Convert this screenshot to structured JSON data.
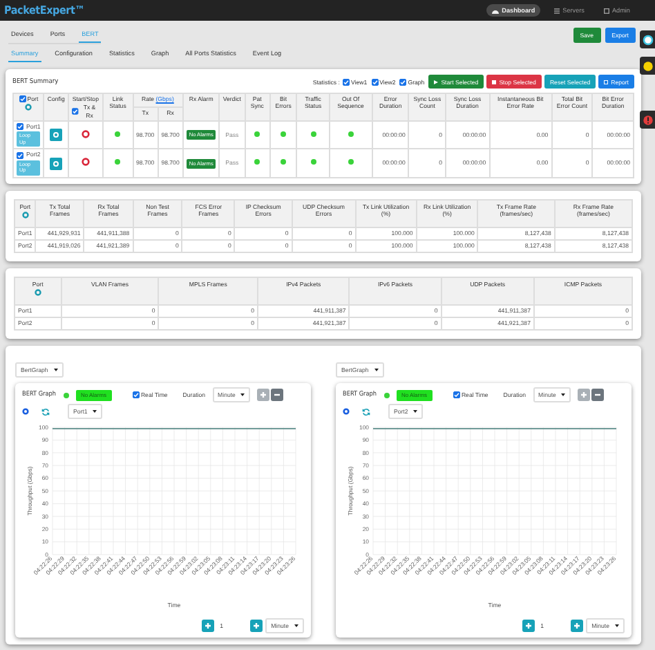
{
  "header": {
    "brand": "PacketExpert™",
    "nav": [
      {
        "label": "Dashboard",
        "selected": true,
        "kind": "dashboard"
      },
      {
        "label": "Servers",
        "selected": false,
        "kind": "servers"
      },
      {
        "label": "Admin",
        "selected": false,
        "kind": "admin"
      }
    ]
  },
  "tabs": [
    {
      "label": "Devices",
      "selected": false
    },
    {
      "label": "Ports",
      "selected": false
    },
    {
      "label": "BERT",
      "selected": true
    }
  ],
  "actions": [
    {
      "label": "Save",
      "kind": "success"
    },
    {
      "label": "Export",
      "kind": "primary"
    }
  ],
  "subtabs": [
    {
      "label": "Summary",
      "selected": true
    },
    {
      "label": "Configuration",
      "selected": false
    },
    {
      "label": "Statistics",
      "selected": false
    },
    {
      "label": "Graph",
      "selected": false
    },
    {
      "label": "All Ports Statistics",
      "selected": false
    },
    {
      "label": "Event Log",
      "selected": false
    }
  ],
  "summary": {
    "title": "BERT Summary",
    "statistics_label": "Statistics :",
    "views": [
      {
        "label": "View1",
        "checked": true
      },
      {
        "label": "View2",
        "checked": true
      },
      {
        "label": "Graph",
        "checked": true
      }
    ],
    "buttons": [
      {
        "label": "Start Selected",
        "kind": "success"
      },
      {
        "label": "Stop Selected",
        "kind": "danger"
      },
      {
        "label": "Reset Selected",
        "kind": "info"
      },
      {
        "label": "Report",
        "kind": "primary"
      }
    ],
    "head": {
      "port": "Port",
      "port_checked": true,
      "config": "Config",
      "start_stop": "Start/Stop",
      "txrx": "Tx & Rx",
      "txrx_checked": true,
      "link_status": "Link Status",
      "rate": "Rate",
      "rate_unit": "(Gbps)",
      "tx": "Tx",
      "rx": "Rx",
      "other": [
        "Rx Alarm",
        "Verdict",
        "Pat Sync",
        "Bit Errors",
        "Traffic Status",
        "Out Of Sequence",
        "Error Duration",
        "Sync Loss Count",
        "Sync Loss Duration",
        "Instantaneous Bit Error Rate",
        "Total Bit Error Count",
        "Bit Error Duration"
      ]
    },
    "rows": [
      {
        "port": "Port1",
        "checked": true,
        "loop": "Loop Up",
        "link_ok": true,
        "tx": "98.700",
        "rx": "98.700",
        "alarm": "No Alarms",
        "verdict": "Pass",
        "pat_sync": true,
        "bit_errors": true,
        "traffic": true,
        "sequence": true,
        "error_duration": "00:00:00",
        "sync_loss_count": "0",
        "sync_loss_duration": "00:00:00",
        "ber": "0.00",
        "total_bit_errors": "0",
        "bit_error_duration": "00:00:00"
      },
      {
        "port": "Port2",
        "checked": true,
        "loop": "Loop Up",
        "link_ok": true,
        "tx": "98.700",
        "rx": "98.700",
        "alarm": "No Alarms",
        "verdict": "Pass",
        "pat_sync": true,
        "bit_errors": true,
        "traffic": true,
        "sequence": true,
        "error_duration": "00:00:00",
        "sync_loss_count": "0",
        "sync_loss_duration": "00:00:00",
        "ber": "0.00",
        "total_bit_errors": "0",
        "bit_error_duration": "00:00:00"
      }
    ]
  },
  "frame_stats": {
    "columns": [
      "Port",
      "Tx Total Frames",
      "Rx Total Frames",
      "Non Test Frames",
      "FCS Error Frames",
      "IP Checksum Errors",
      "UDP Checksum Errors",
      "Tx Link Utilization (%)",
      "Rx Link Utilization (%)",
      "Tx Frame Rate (frames/sec)",
      "Rx Frame Rate (frames/sec)"
    ],
    "rows": [
      [
        "Port1",
        "441,929,931",
        "441,911,388",
        "0",
        "0",
        "0",
        "0",
        "100.000",
        "100.000",
        "8,127,438",
        "8,127,438"
      ],
      [
        "Port2",
        "441,919,026",
        "441,921,389",
        "0",
        "0",
        "0",
        "0",
        "100.000",
        "100.000",
        "8,127,438",
        "8,127,438"
      ]
    ]
  },
  "packet_stats": {
    "columns": [
      "Port",
      "VLAN Frames",
      "MPLS Frames",
      "IPv4 Packets",
      "IPv6 Packets",
      "UDP Packets",
      "ICMP Packets"
    ],
    "rows": [
      [
        "Port1",
        "0",
        "0",
        "441,911,387",
        "0",
        "441,911,387",
        "0"
      ],
      [
        "Port2",
        "0",
        "0",
        "441,921,387",
        "0",
        "441,921,387",
        "0"
      ]
    ]
  },
  "graphs": [
    {
      "selector": "BertGraph",
      "title": "BERT Graph",
      "status_ok": true,
      "alarm": "No Alarms",
      "realtime": {
        "label": "Real Time",
        "checked": true
      },
      "duration_label": "Duration",
      "duration": "Minute",
      "port": "Port1",
      "step": "1",
      "unit": "Minute",
      "chart_data": {
        "type": "line",
        "xlabel": "Time",
        "ylabel": "Throughput (Gbps)",
        "ylim": [
          0,
          100
        ],
        "yticks": [
          0,
          10,
          20,
          30,
          40,
          50,
          60,
          70,
          80,
          90,
          100
        ],
        "categories": [
          "04:22:26",
          "04:22:29",
          "04:22:32",
          "04:22:35",
          "04:22:38",
          "04:22:41",
          "04:22:44",
          "04:22:47",
          "04:22:50",
          "04:22:53",
          "04:22:56",
          "04:22:59",
          "04:23:02",
          "04:23:05",
          "04:23:08",
          "04:23:11",
          "04:23:14",
          "04:23:17",
          "04:23:20",
          "04:23:23",
          "04:23:26"
        ],
        "grid": true,
        "series": [
          {
            "color": "#5f8f8c",
            "values": [
              99,
              99,
              99,
              99,
              99,
              99,
              99,
              99,
              99,
              99,
              99,
              99,
              99,
              99,
              99,
              99,
              99,
              99,
              99,
              99,
              99
            ]
          }
        ]
      }
    },
    {
      "selector": "BertGraph",
      "title": "BERT Graph",
      "status_ok": true,
      "alarm": "No Alarms",
      "realtime": {
        "label": "Real Time",
        "checked": true
      },
      "duration_label": "Duration",
      "duration": "Minute",
      "port": "Port2",
      "step": "1",
      "unit": "Minute",
      "chart_data": {
        "type": "line",
        "xlabel": "Time",
        "ylabel": "Throughput (Gbps)",
        "ylim": [
          0,
          100
        ],
        "yticks": [
          0,
          10,
          20,
          30,
          40,
          50,
          60,
          70,
          80,
          90,
          100
        ],
        "categories": [
          "04:22:26",
          "04:22:29",
          "04:22:32",
          "04:22:35",
          "04:22:38",
          "04:22:41",
          "04:22:44",
          "04:22:47",
          "04:22:50",
          "04:22:53",
          "04:22:56",
          "04:22:59",
          "04:23:02",
          "04:23:05",
          "04:23:08",
          "04:23:11",
          "04:23:14",
          "04:23:17",
          "04:23:20",
          "04:23:23",
          "04:23:26"
        ],
        "grid": true,
        "series": [
          {
            "color": "#5f8f8c",
            "values": [
              99,
              99,
              99,
              99,
              99,
              99,
              99,
              99,
              99,
              99,
              99,
              99,
              99,
              99,
              99,
              99,
              99,
              99,
              99,
              99,
              99
            ]
          }
        ]
      }
    }
  ]
}
